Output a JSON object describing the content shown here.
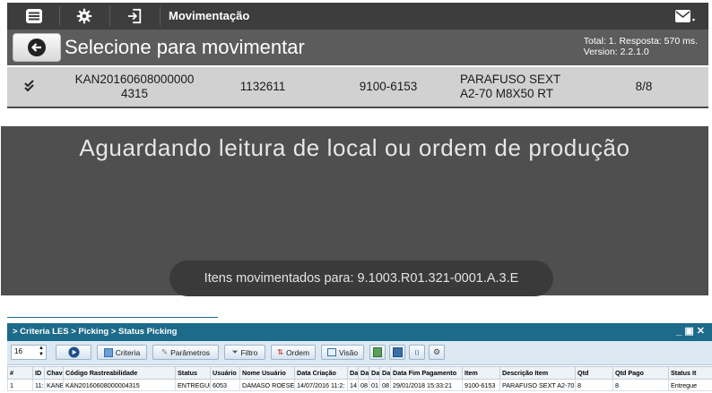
{
  "panel1": {
    "title": "Movimentação",
    "header_title": "Selecione para movimentar",
    "total_text": "Total: 1. Resposta: 570 ms.",
    "version_text": "Version: 2.2.1.0",
    "row": {
      "code_line1": "KAN20160608000000",
      "code_line2": "4315",
      "number": "1132611",
      "part": "9100-6153",
      "desc_line1": "PARAFUSO SEXT",
      "desc_line2": "A2-70  M8X50 RT",
      "count": "8/8"
    }
  },
  "panel2": {
    "message": "Aguardando leitura de local ou ordem de produção",
    "moved": "Itens movimentados para: 9.1003.R01.321-0001.A.3.E"
  },
  "panel3": {
    "breadcrumb": "> Criteria LES > Picking > Status Picking",
    "window_controls": "_ ▣ ✕",
    "page_size": "16",
    "buttons": {
      "criteria": "Criteria",
      "parametros": "Parâmetros",
      "filtro": "Filtro",
      "ordem": "Ordem",
      "visao": "Visão"
    },
    "columns": [
      "#",
      "ID",
      "Chave",
      "Código Rastreabilidade",
      "Status",
      "Usuário",
      "Nome Usuário",
      "Data Criação",
      "Da",
      "Da",
      "Da",
      "Da",
      "Data Fim Pagamento",
      "Item",
      "Descrição Item",
      "Qtd",
      "Qtd Pago",
      "Status It"
    ],
    "row": [
      "1",
      "11:",
      "KANB",
      "KAN20160608000004315",
      "ENTREGUE",
      "6053",
      "DAMASO ROESE D.",
      "14/07/2016 11:2:",
      "14",
      "08",
      "01",
      "08",
      "29/01/2018 15:33:21",
      "9100-6153",
      "PARAFUSO SEXT A2-70  M",
      "8",
      "8",
      "Entregue"
    ]
  }
}
